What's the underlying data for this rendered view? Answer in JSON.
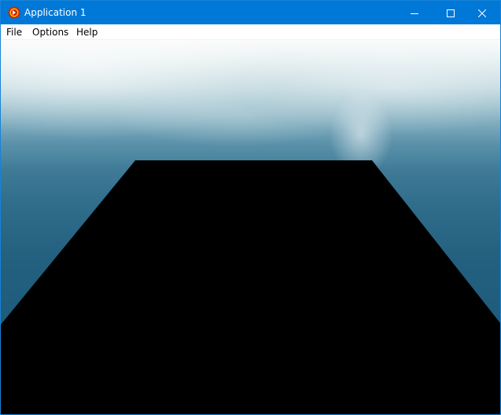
{
  "window": {
    "title": "Application 1",
    "app_icon": "app-logo-icon",
    "controls": [
      "minimize-icon",
      "maximize-icon",
      "close-icon"
    ],
    "accent": "#0078d7"
  },
  "menu": {
    "file": "File",
    "options": "Options",
    "help": "Help"
  },
  "scene": {
    "sky_top": "#fbfcfb",
    "water": "#1e5878",
    "floor_color": "#000000"
  }
}
